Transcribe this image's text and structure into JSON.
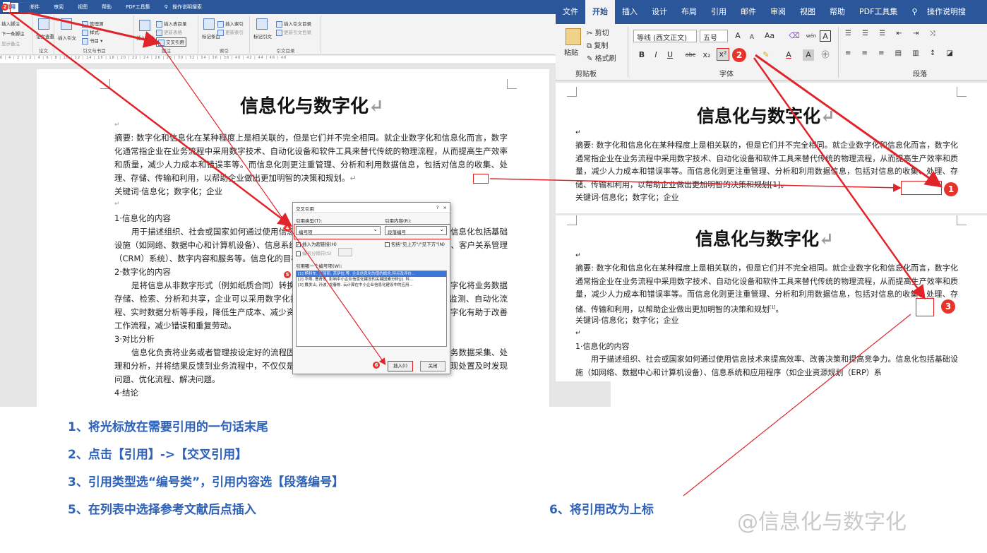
{
  "left_window": {
    "tabs": [
      "引用",
      "邮件",
      "审阅",
      "视图",
      "帮助",
      "PDF工具集",
      "操作说明搜索"
    ],
    "tab_extra": "2",
    "ribbon": {
      "groups": [
        "论文",
        "引文与书目",
        "题注",
        "索引",
        "引文目录"
      ],
      "items": {
        "insert_footnote": "插入脚注",
        "next_footnote": "下一条脚注",
        "show_notes": "显示备注",
        "paper_check": "论文查重",
        "insert_citation": "插入引文",
        "manage_sources": "管理源",
        "style": "样式:",
        "bibliography": "书目",
        "insert_caption": "插入题注",
        "insert_table_of_figures": "插入表目录",
        "update_table": "更新表格",
        "cross_reference": "交叉引用",
        "mark_entry": "标记条目",
        "insert_index": "插入索引",
        "update_index": "更新索引",
        "mark_citation": "标记引文",
        "insert_table_of_authorities": "插入引文目录",
        "update_table_auth": "更新引文目录"
      }
    },
    "ruler_text": "6 | 4 | 2 |   | 2 | 4 | 6 | 8 | 10 | 12 | 14 | 16 | 18 | 20 | 22 | 24 | 26 | 28 | 30 | 32 | 34 | 36 | 38 | 40 | 42 | 44 | 46 | 48",
    "doc": {
      "title": "信息化与数字化",
      "mark": "↵",
      "abstract": "摘要: 数字化和信息化在某种程度上是相关联的，但是它们并不完全相同。就企业数字化和信息化而言，数字化通常指企业在业务流程中采用数字技术、自动化设备和软件工具来替代传统的物理流程，从而提高生产效率和质量，减少人力成本和错误率等。而信息化则更注重管理、分析和利用数据信息，包括对信息的收集、处理、存储、传输和利用，以帮助企业做出更加明智的决策和规划。",
      "keywords": "关键词·信息化；数字化；企业",
      "h1": "1·信息化的内容",
      "p1": "用于描述组织、社会或国家如何通过使用信息技术来提高效率、改善决策和提高竞争力。信息化包括基础设施（如网络、数据中心和计算机设备）、信息系统和应用程序（如企业资源规划（ERP）系统、客户关系管理（CRM）系统）、数字内容和服务等。信息化的目标是提高信息的可用性和支持[1]。",
      "h2": "2·数字化的内容",
      "p2": "是将信息从非数字形式（例如纸质合同）转换为数字形式，以便于计算机处理的过程。数字化将业务数据存储、检索、分析和共享，企业可以采用数字化技术对业务流程进行优化和改进，通过实时监测、自动化流程、实时数据分析等手段，降低生产成本、减少资源浪费、优化供应链，从而提升竞争力。数字化有助于改善工作流程，减少错误和重复劳动。",
      "h3": "3·对比分析",
      "p3": "信息化负责将业务或者管理按设定好的流程固化下来，数字化则是通过数据的方式，对业务数据采集、处理和分析，并将结果反馈到业务流程中，不仅仅是数字化和信息化在企业中的实现，还可以实现处置及时发现问题、优化流程、解决问题。",
      "h4": "4·结论"
    },
    "dialog": {
      "title": "交叉引用",
      "help": "?",
      "close": "×",
      "ref_type_label": "引用类型(T):",
      "ref_type_value": "编号项",
      "ref_content_label": "引用内容(R):",
      "ref_content_value": "段落编号",
      "insert_hyperlink": "插入为超链接(H)",
      "include_above_below": "包括\"见上方\"/\"见下方\"(N)",
      "separate_numbers": "编号分隔符(S)",
      "list_label": "引用哪一个编号项(W):",
      "items": [
        "[1] 杨科东, 王丽丽, 苏伊拉,等. 企业信息化的值的概念,特点及评价...",
        "[2] 华燕, 曹青安. 影响中小企业信息化建设的关键因素分析[J]. 科...",
        "[3] 戴发山, 孙波, 龙春栋. 云计算在中小企业信息化建设中的应用..."
      ],
      "insert_button": "插入(I)",
      "close_button": "关闭"
    },
    "badges": {
      "b1": "2",
      "b3": "3",
      "b4": "4",
      "b5": "5",
      "b6": "6"
    }
  },
  "right_window": {
    "tabs": [
      "文件",
      "开始",
      "插入",
      "设计",
      "布局",
      "引用",
      "邮件",
      "审阅",
      "视图",
      "帮助",
      "PDF工具集",
      "操作说明搜"
    ],
    "active_tab": "开始",
    "clipboard": {
      "paste": "粘贴",
      "cut": "剪切",
      "copy": "复制",
      "format_painter": "格式刷",
      "group": "剪贴板"
    },
    "font": {
      "name": "等线 (西文正文)",
      "size": "五号",
      "group": "字体",
      "grow": "A",
      "shrink": "A",
      "case": "Aa",
      "bold": "B",
      "italic": "I",
      "underline": "U",
      "strike": "abc",
      "sub": "x₂",
      "sup": "x²",
      "wen": "wén",
      "box": "A",
      "circle": "㊉"
    },
    "paragraph_group": "段落",
    "badge": "2",
    "doc1": {
      "title": "信息化与数字化",
      "abstract": "摘要: 数字化和信息化在某种程度上是相关联的，但是它们并不完全相同。就企业数字化和信息化而言，数字化通常指企业在业务流程中采用数字技术、自动化设备和软件工具来替代传统的物理流程，从而提高生产效率和质量，减少人力成本和错误率等。而信息化则更注重管理、分析和利用数据信息，包括对信息的收集、处理、存储、传输和利用，以帮助企业做出更加明智的决策和规划[1]。",
      "keywords": "关键词·信息化；数字化；企业",
      "badge": "1"
    },
    "doc2": {
      "title": "信息化与数字化",
      "abstract": "摘要: 数字化和信息化在某种程度上是相关联的，但是它们并不完全相同。就企业数字化和信息化而言，数字化通常指企业在业务流程中采用数字技术、自动化设备和软件工具来替代传统的物理流程，从而提高生产效率和质量，减少人力成本和错误率等。而信息化则更注重管理、分析和利用数据信息，包括对信息的收集、处理、存储、传输和利用，以帮助企业做出更加明智的决策和规划",
      "sup": "[1]",
      "keywords": "关键词·信息化；数字化；企业",
      "h1": "1·信息化的内容",
      "p1": "用于描述组织、社会或国家如何通过使用信息技术来提高效率、改善决策和提高竞争力。信息化包括基础设施（如网络、数据中心和计算机设备）、信息系统和应用程序（如企业资源规划（ERP）系",
      "badge": "3"
    }
  },
  "steps": [
    "1、将光标放在需要引用的一句话末尾",
    "2、点击【引用】->【交叉引用】",
    "3、引用类型选“编号类”，引用内容选【段落编号】",
    "5、在列表中选择参考文献后点插入",
    "6、将引用改为上标"
  ],
  "watermark": "@信息化与数字化",
  "colors": {
    "arrow": "#e0242a",
    "accent": "#2b579a",
    "step": "#2e62b8"
  }
}
